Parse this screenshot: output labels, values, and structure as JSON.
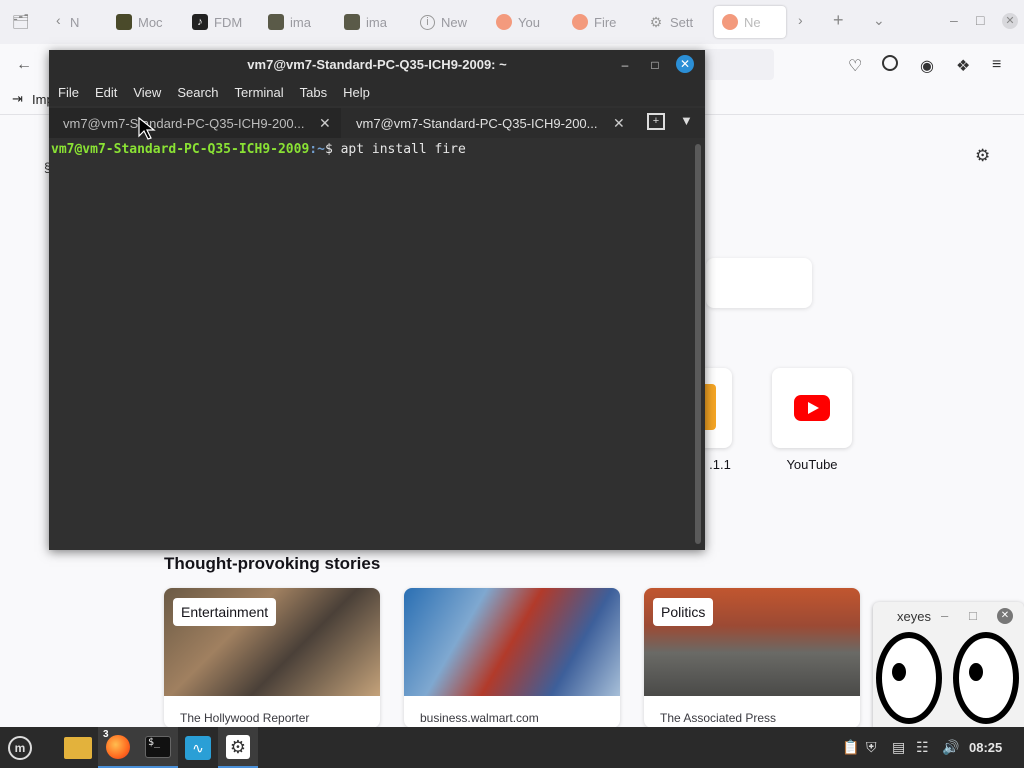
{
  "browser": {
    "tabs": [
      {
        "label": "N",
        "icon": "firefox-tab-icon"
      },
      {
        "label": "Moc",
        "icon": "image-thumb-icon"
      },
      {
        "label": "FDM",
        "icon": "tiktok-icon"
      },
      {
        "label": "ima",
        "icon": "image-thumb-icon"
      },
      {
        "label": "ima",
        "icon": "image-thumb-icon"
      },
      {
        "label": "New",
        "icon": "info-icon"
      },
      {
        "label": "You",
        "icon": "firefox-icon"
      },
      {
        "label": "Fire",
        "icon": "firefox-icon"
      },
      {
        "label": "Sett",
        "icon": "gear-icon"
      },
      {
        "label": "Ne",
        "icon": "firefox-icon"
      }
    ],
    "bookmark_label": "Imp",
    "shortcuts": [
      {
        "label": ".1.1"
      },
      {
        "label": "YouTube"
      }
    ],
    "stories_title": "Thought-provoking stories",
    "stories": [
      {
        "tag": "Entertainment",
        "source": "The Hollywood Reporter"
      },
      {
        "tag": "",
        "source": "business.walmart.com"
      },
      {
        "tag": "Politics",
        "source": "The Associated Press"
      }
    ]
  },
  "terminal": {
    "title": "vm7@vm7-Standard-PC-Q35-ICH9-2009: ~",
    "menu": [
      "File",
      "Edit",
      "View",
      "Search",
      "Terminal",
      "Tabs",
      "Help"
    ],
    "tabs": [
      {
        "label": "vm7@vm7-Standard-PC-Q35-ICH9-200..."
      },
      {
        "label": "vm7@vm7-Standard-PC-Q35-ICH9-200..."
      }
    ],
    "prompt_user": "vm7@vm7-Standard-PC-Q35-ICH9-2009",
    "prompt_path": ":~",
    "prompt_symbol": "$ ",
    "command": "apt install fire"
  },
  "xeyes": {
    "title": "xeyes",
    "minimize_label": "–",
    "maximize_label": "□"
  },
  "taskbar": {
    "firefox_badge": "3",
    "clock": "08:25"
  }
}
